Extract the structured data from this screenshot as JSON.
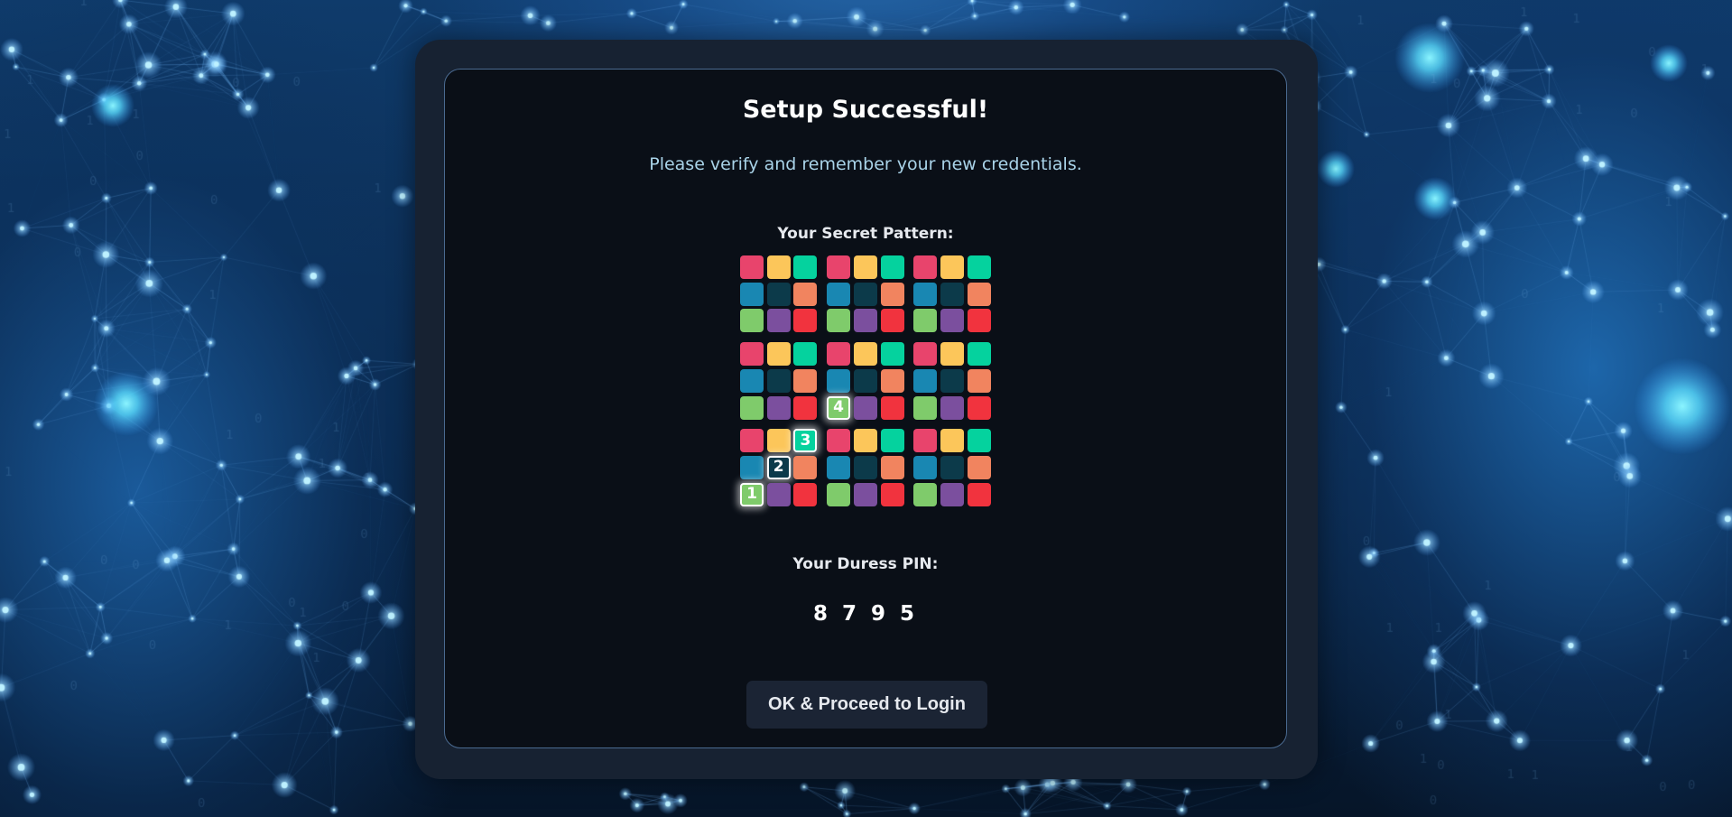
{
  "background": {
    "description_icon": "network-constellation-background"
  },
  "dialog": {
    "title": "Setup Successful!",
    "subtitle": "Please verify and remember your new credentials.",
    "pattern_label": "Your Secret Pattern:",
    "pin_label": "Your Duress PIN:",
    "pin_value": "8 7 9 5",
    "ok_button_label": "OK & Proceed to Login"
  },
  "pattern": {
    "block_colors": [
      [
        "#e8446c",
        "#fcc65a",
        "#05d29e"
      ],
      [
        "#1987b2",
        "#0c3a4a",
        "#f1845f"
      ],
      [
        "#7fcb6b",
        "#7b4f9e",
        "#f1333e"
      ]
    ],
    "selected": [
      {
        "row": 8,
        "col": 0,
        "order": "1"
      },
      {
        "row": 7,
        "col": 1,
        "order": "2"
      },
      {
        "row": 6,
        "col": 2,
        "order": "3"
      },
      {
        "row": 5,
        "col": 3,
        "order": "4"
      }
    ]
  }
}
